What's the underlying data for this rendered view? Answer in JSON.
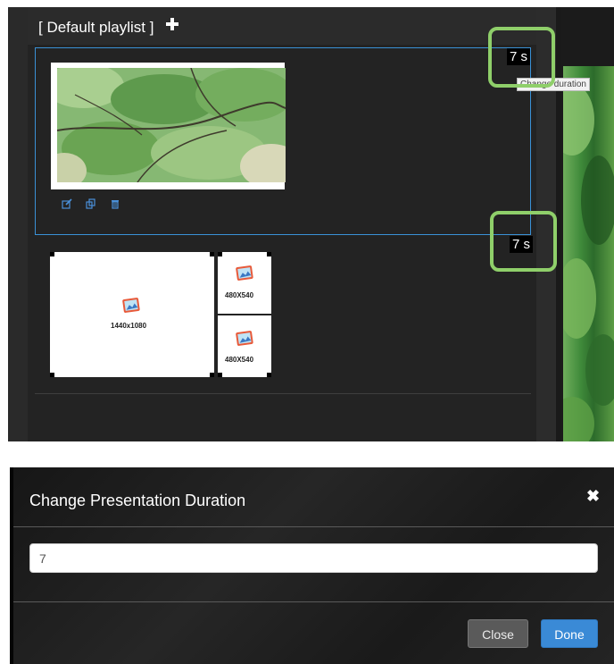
{
  "playlist": {
    "title": "[ Default playlist ]",
    "add_icon": "plus-icon",
    "slide": {
      "thumbnail": "leaves-image",
      "actions": [
        "edit-icon",
        "copy-icon",
        "trash-icon"
      ],
      "duration": "7 s",
      "tooltip": "Change duration"
    },
    "next_duration": "7 s",
    "layout": {
      "zones": [
        {
          "label": "1440x1080"
        },
        {
          "label": "480X540"
        },
        {
          "label": "480X540"
        }
      ]
    }
  },
  "modal": {
    "title": "Change Presentation Duration",
    "close_icon": "close-icon",
    "input_value": "7",
    "close_label": "Close",
    "done_label": "Done"
  },
  "colors": {
    "highlight": "#8fcf6a",
    "selection_border": "#3a91d6",
    "done_button": "#3a8ad6"
  }
}
